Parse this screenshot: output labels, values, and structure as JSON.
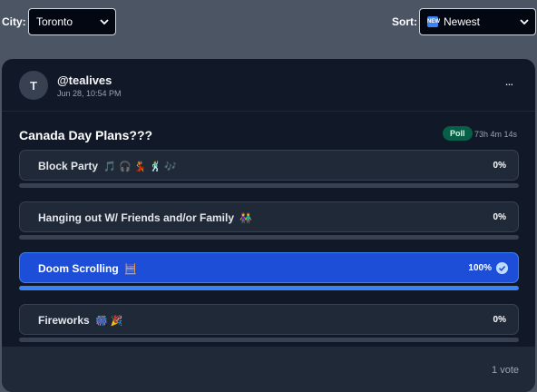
{
  "filters": {
    "city_label": "City:",
    "city_value": "Toronto",
    "sort_label": "Sort:",
    "sort_icon_text": "NEW",
    "sort_value": "Newest"
  },
  "post": {
    "avatar_initial": "T",
    "username": "@tealives",
    "timestamp": "Jun 28, 10:54 PM",
    "more_label": "...",
    "title": "Canada Day Plans???",
    "badge": "Poll",
    "time_remaining": "73h 4m 14s",
    "options": [
      {
        "label": "Block Party",
        "emoji": "🎵 🎧 💃 🕺 🎶",
        "percent": "0%",
        "fill": 0,
        "selected": false
      },
      {
        "label": "Hanging out W/ Friends and/or Family",
        "emoji": "👫",
        "percent": "0%",
        "fill": 0,
        "selected": false
      },
      {
        "label": "Doom Scrolling",
        "emoji": "🧮",
        "percent": "100%",
        "fill": 1,
        "selected": true
      },
      {
        "label": "Fireworks",
        "emoji": "🎆 🎉",
        "percent": "0%",
        "fill": 0,
        "selected": false
      }
    ],
    "votes": "1 vote"
  },
  "colors": {
    "background": "#4b5563",
    "card": "#111827",
    "selected_option": "#1d4ed8",
    "accent": "#3b82f6",
    "poll_badge": "#065f46"
  }
}
